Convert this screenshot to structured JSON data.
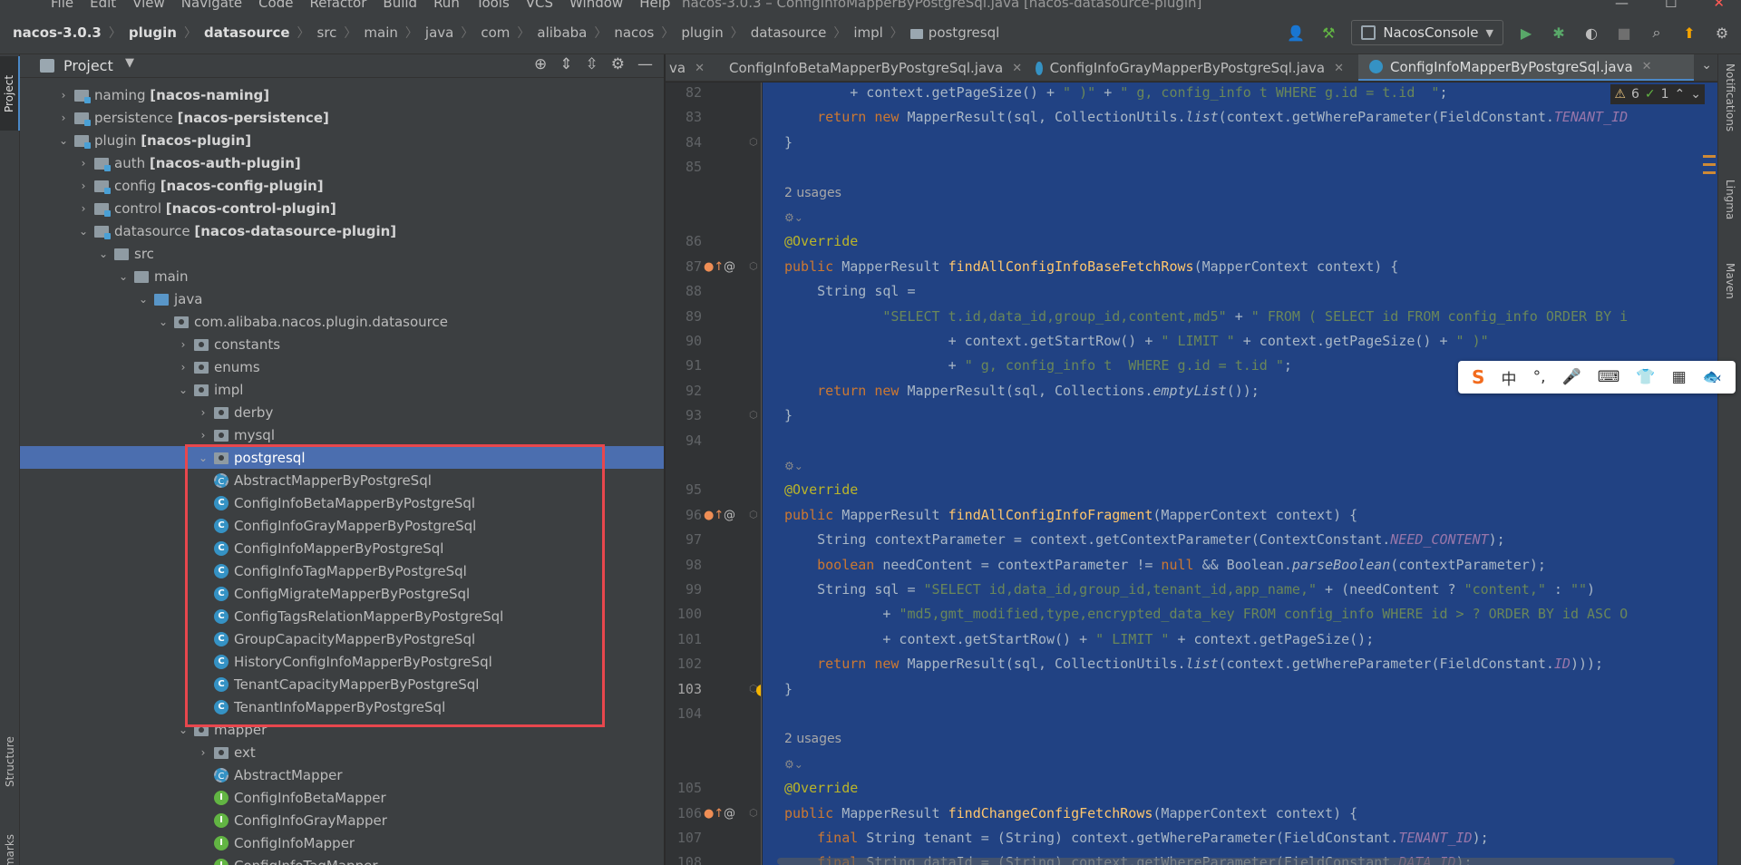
{
  "menubar": {
    "items": [
      "File",
      "Edit",
      "View",
      "Navigate",
      "Code",
      "Refactor",
      "Build",
      "Run",
      "Tools",
      "VCS",
      "Window",
      "Help"
    ],
    "window_title": "nacos-3.0.3 – ConfigInfoMapperByPostgreSql.java [nacos-datasource-plugin]"
  },
  "breadcrumb": [
    "nacos-3.0.3",
    "plugin",
    "datasource",
    "src",
    "main",
    "java",
    "com",
    "alibaba",
    "nacos",
    "plugin",
    "datasource",
    "impl",
    "postgresql"
  ],
  "run_config": "NacosConsole",
  "project_panel": {
    "title": "Project",
    "tree": [
      {
        "label": "naming",
        "module": "[nacos-naming]",
        "type": "module",
        "arrow": "›"
      },
      {
        "label": "persistence",
        "module": "[nacos-persistence]",
        "type": "module",
        "arrow": "›"
      },
      {
        "label": "plugin",
        "module": "[nacos-plugin]",
        "type": "module",
        "arrow": "⌄"
      },
      {
        "label": "auth",
        "module": "[nacos-auth-plugin]",
        "type": "module",
        "arrow": "›"
      },
      {
        "label": "config",
        "module": "[nacos-config-plugin]",
        "type": "module",
        "arrow": "›"
      },
      {
        "label": "control",
        "module": "[nacos-control-plugin]",
        "type": "module",
        "arrow": "›"
      },
      {
        "label": "datasource",
        "module": "[nacos-datasource-plugin]",
        "type": "module",
        "arrow": "⌄"
      },
      {
        "label": "src",
        "module": "",
        "type": "folder",
        "arrow": "⌄"
      },
      {
        "label": "main",
        "module": "",
        "type": "folder",
        "arrow": "⌄"
      },
      {
        "label": "java",
        "module": "",
        "type": "src",
        "arrow": "⌄"
      },
      {
        "label": "com.alibaba.nacos.plugin.datasource",
        "module": "",
        "type": "pkg",
        "arrow": "⌄"
      },
      {
        "label": "constants",
        "module": "",
        "type": "pkg",
        "arrow": "›"
      },
      {
        "label": "enums",
        "module": "",
        "type": "pkg",
        "arrow": "›"
      },
      {
        "label": "impl",
        "module": "",
        "type": "pkg",
        "arrow": "⌄"
      },
      {
        "label": "derby",
        "module": "",
        "type": "pkg",
        "arrow": "›"
      },
      {
        "label": "mysql",
        "module": "",
        "type": "pkg",
        "arrow": "›"
      },
      {
        "label": "postgresql",
        "module": "",
        "type": "pkg",
        "arrow": "⌄"
      },
      {
        "label": "AbstractMapperByPostgreSql",
        "module": "",
        "type": "abs",
        "arrow": ""
      },
      {
        "label": "ConfigInfoBetaMapperByPostgreSql",
        "module": "",
        "type": "cls",
        "arrow": ""
      },
      {
        "label": "ConfigInfoGrayMapperByPostgreSql",
        "module": "",
        "type": "cls",
        "arrow": ""
      },
      {
        "label": "ConfigInfoMapperByPostgreSql",
        "module": "",
        "type": "cls",
        "arrow": ""
      },
      {
        "label": "ConfigInfoTagMapperByPostgreSql",
        "module": "",
        "type": "cls",
        "arrow": ""
      },
      {
        "label": "ConfigMigrateMapperByPostgreSql",
        "module": "",
        "type": "cls",
        "arrow": ""
      },
      {
        "label": "ConfigTagsRelationMapperByPostgreSql",
        "module": "",
        "type": "cls",
        "arrow": ""
      },
      {
        "label": "GroupCapacityMapperByPostgreSql",
        "module": "",
        "type": "cls",
        "arrow": ""
      },
      {
        "label": "HistoryConfigInfoMapperByPostgreSql",
        "module": "",
        "type": "cls",
        "arrow": ""
      },
      {
        "label": "TenantCapacityMapperByPostgreSql",
        "module": "",
        "type": "cls",
        "arrow": ""
      },
      {
        "label": "TenantInfoMapperByPostgreSql",
        "module": "",
        "type": "cls",
        "arrow": ""
      },
      {
        "label": "mapper",
        "module": "",
        "type": "pkg",
        "arrow": "⌄"
      },
      {
        "label": "ext",
        "module": "",
        "type": "pkg",
        "arrow": "›"
      },
      {
        "label": "AbstractMapper",
        "module": "",
        "type": "abs",
        "arrow": ""
      },
      {
        "label": "ConfigInfoBetaMapper",
        "module": "",
        "type": "intf",
        "arrow": ""
      },
      {
        "label": "ConfigInfoGrayMapper",
        "module": "",
        "type": "intf",
        "arrow": ""
      },
      {
        "label": "ConfigInfoMapper",
        "module": "",
        "type": "intf",
        "arrow": ""
      },
      {
        "label": "ConfigInfoTagMapper",
        "module": "",
        "type": "intf",
        "arrow": ""
      }
    ],
    "selected_index": 16
  },
  "editor_tabs": [
    {
      "label": "va",
      "active": false
    },
    {
      "label": "ConfigInfoBetaMapperByPostgreSql.java",
      "active": false
    },
    {
      "label": "ConfigInfoGrayMapperByPostgreSql.java",
      "active": false
    },
    {
      "label": "ConfigInfoMapperByPostgreSql.java",
      "active": true
    }
  ],
  "inspection": {
    "warnings": "6",
    "ok": "1"
  },
  "right_tabs": [
    "Notifications",
    "Lingma",
    "Maven"
  ],
  "left_tabs": [
    "Project",
    "Structure",
    "Bookmarks"
  ],
  "ime_bar": [
    "S",
    "中",
    "°,",
    "🎤",
    "⌨",
    "👕",
    "▦",
    "🐟"
  ],
  "gutter_lines": [
    "82",
    "83",
    "84",
    "85",
    "",
    "",
    "86",
    "87",
    "88",
    "89",
    "90",
    "91",
    "92",
    "93",
    "94",
    "",
    "95",
    "96",
    "97",
    "98",
    "99",
    "100",
    "101",
    "102",
    "103",
    "104",
    "",
    "",
    "105",
    "106",
    "107",
    "108"
  ],
  "current_line": "103",
  "code_lines": [
    "        + context.getPageSize() + \" )\" + \" g, config_info t WHERE g.id = t.id  \";",
    "    return new MapperResult(sql, CollectionUtils.list(context.getWhereParameter(FieldConstant.TENANT_ID",
    "}",
    "",
    "2 usages",
    "⚙⌄",
    "@Override",
    "public MapperResult findAllConfigInfoBaseFetchRows(MapperContext context) {",
    "    String sql =",
    "            \"SELECT t.id,data_id,group_id,content,md5\" + \" FROM ( SELECT id FROM config_info ORDER BY i",
    "                    + context.getStartRow() + \" LIMIT \" + context.getPageSize() + \" )\"",
    "                    + \" g, config_info t  WHERE g.id = t.id \";",
    "    return new MapperResult(sql, Collections.emptyList());",
    "}",
    "",
    "⚙⌄",
    "@Override",
    "public MapperResult findAllConfigInfoFragment(MapperContext context) {",
    "    String contextParameter = context.getContextParameter(ContextConstant.NEED_CONTENT);",
    "    boolean needContent = contextParameter != null && Boolean.parseBoolean(contextParameter);",
    "    String sql = \"SELECT id,data_id,group_id,tenant_id,app_name,\" + (needContent ? \"content,\" : \"\")",
    "            + \"md5,gmt_modified,type,encrypted_data_key FROM config_info WHERE id > ? ORDER BY id ASC O",
    "            + context.getStartRow() + \" LIMIT \" + context.getPageSize();",
    "    return new MapperResult(sql, CollectionUtils.list(context.getWhereParameter(FieldConstant.ID)));",
    "}",
    "",
    "2 usages",
    "⚙⌄",
    "@Override",
    "public MapperResult findChangeConfigFetchRows(MapperContext context) {",
    "    final String tenant = (String) context.getWhereParameter(FieldConstant.TENANT_ID);",
    "    final String dataId = (String) context.getWhereParameter(FieldConstant.DATA_ID);"
  ],
  "colors": {
    "selection": "#214283",
    "tree_selection": "#4b6eaf",
    "highlight_box": "#e8474d",
    "keyword": "#cc7832",
    "string": "#6a8759",
    "method": "#ffc66d",
    "annotation": "#bbb529",
    "constant": "#9876aa"
  }
}
